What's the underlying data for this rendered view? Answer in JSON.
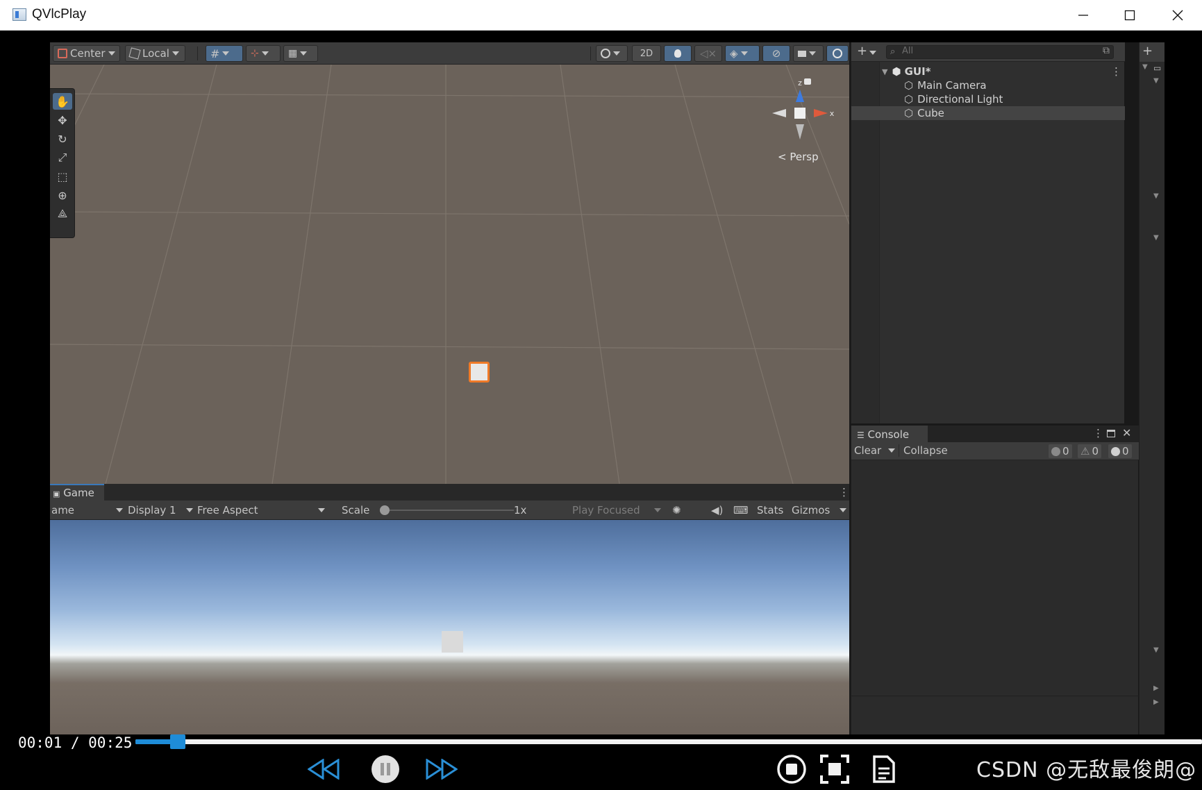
{
  "window": {
    "title": "QVlcPlay"
  },
  "scene_toolbar": {
    "pivot_label": "Center",
    "space_label": "Local",
    "mode_2d_label": "2D"
  },
  "scene_view": {
    "camera_label": "Persp",
    "gizmo_axes": {
      "z": "z",
      "x": "x"
    }
  },
  "game_tab": {
    "label": "Game",
    "target_partial": "ame",
    "display": "Display 1",
    "aspect": "Free Aspect",
    "scale_label": "Scale",
    "scale_value": "1x",
    "play_mode": "Play Focused",
    "stats_label": "Stats",
    "gizmos_label": "Gizmos"
  },
  "hierarchy": {
    "search_placeholder": "All",
    "scene_name": "GUI*",
    "items": [
      {
        "label": "Main Camera"
      },
      {
        "label": "Directional Light"
      },
      {
        "label": "Cube",
        "selected": true
      }
    ]
  },
  "console": {
    "tab_label": "Console",
    "clear_label": "Clear",
    "collapse_label": "Collapse",
    "log_count": "0",
    "warning_count": "0",
    "error_count": "0"
  },
  "player": {
    "current_time": "00:01",
    "total_time": "00:25",
    "time_separator": " / ",
    "progress_fraction": 0.04,
    "accent_color": "#1e8cd8"
  },
  "watermark": {
    "text": "CSDN @无敌最俊朗@"
  },
  "colors": {
    "scene_bg": "#6b625a",
    "editor_panel": "#3c3c3c",
    "selection_outline": "#f07a28",
    "active_tool": "#4c6b8c"
  }
}
